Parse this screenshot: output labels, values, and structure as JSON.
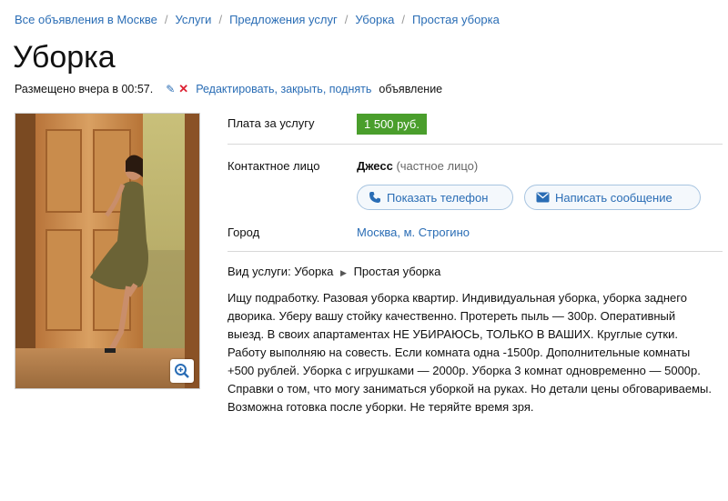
{
  "breadcrumb": [
    "Все объявления в Москве",
    "Услуги",
    "Предложения услуг",
    "Уборка",
    "Простая уборка"
  ],
  "title": "Уборка",
  "meta": {
    "posted": "Размещено вчера в 00:57.",
    "actions_link": "Редактировать, закрыть, поднять",
    "actions_suffix": "объявление"
  },
  "price": {
    "label": "Плата за услугу",
    "value": "1 500 руб."
  },
  "contact": {
    "label": "Контактное лицо",
    "name": "Джесс",
    "type": "(частное лицо)",
    "show_phone": "Показать телефон",
    "write_message": "Написать сообщение"
  },
  "city": {
    "label": "Город",
    "value": "Москва, м. Строгино"
  },
  "service": {
    "label": "Вид услуги:",
    "category": "Уборка",
    "subcategory": "Простая уборка"
  },
  "description": "Ищу подработку. Разовая уборка квартир. Индивидуальная уборка, уборка заднего дворика. Уберу вашу стойку качественно. Протереть пыль — 300р. Оперативный выезд. В своих апартаментах НЕ УБИРАЮСЬ, ТОЛЬКО В ВАШИХ. Круглые сутки. Работу выполняю на совесть. Если комната одна -1500р. Дополнительные комнаты +500 рублей. Уборка с игрушками — 2000р. Уборка 3 комнат одновременно — 5000р. Справки о том, что могу заниматься уборкой на руках. Но детали цены обговариваемы. Возможна готовка после уборки. Не теряйте время зря.",
  "colors": {
    "link": "#2a6db5",
    "price_bg": "#4a9e2c"
  },
  "icons": {
    "edit": "pencil-icon",
    "close": "x-icon",
    "phone": "phone-icon",
    "message": "envelope-icon",
    "zoom": "zoom-icon"
  }
}
